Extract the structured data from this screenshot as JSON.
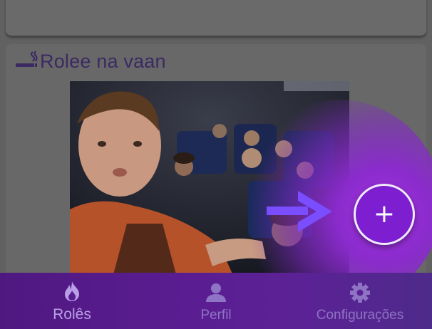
{
  "post": {
    "title": "Rolee na vaan",
    "category_icon": "smoking-icon"
  },
  "fab": {
    "label": "+",
    "icon": "plus-icon"
  },
  "bottom_nav": {
    "items": [
      {
        "label": "Rolês",
        "icon": "flame-icon",
        "active": true
      },
      {
        "label": "Perfil",
        "icon": "person-icon",
        "active": false
      },
      {
        "label": "Configurações",
        "icon": "gear-icon",
        "active": false
      }
    ]
  },
  "colors": {
    "accent": "#7d1fd0",
    "nav_background": "#5a1d91",
    "title_text": "#3b2a63",
    "overlay": "#616161",
    "arrow": "#7a4dff"
  }
}
